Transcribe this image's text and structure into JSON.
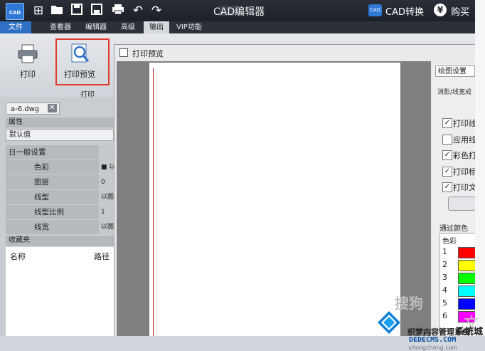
{
  "titlebar": {
    "app_logo": "CAD",
    "title": "CAD编辑器",
    "convert_label": "CAD转换",
    "convert_badge": "CAD",
    "buy_label": "购买",
    "buy_icon": "¥",
    "toolbar_icons": [
      "add-icon",
      "open-folder-icon",
      "save-icon",
      "save-as-icon",
      "print-icon",
      "undo-icon",
      "redo-icon"
    ]
  },
  "menu": {
    "tabs": [
      "文件",
      "查看器",
      "编辑器",
      "高级",
      "输出",
      "VIP功能"
    ],
    "active": "输出"
  },
  "ribbon": {
    "print_label": "打印",
    "preview_label": "打印预览",
    "group_label": "打印",
    "highlight_color": "#e03b2a"
  },
  "leftpanel": {
    "file_tab": "a-6.dwg",
    "file_close": "✕",
    "properties_header": "属性",
    "default_value": "默认值",
    "general_group": "日一般设置",
    "rows": [
      {
        "key": "色彩",
        "value": "■ 以"
      },
      {
        "key": "图层",
        "value": "0"
      },
      {
        "key": "线型",
        "value": "以图"
      },
      {
        "key": "线型比例",
        "value": "1"
      },
      {
        "key": "线宽",
        "value": "以图"
      }
    ],
    "favorites_header": "收藏夹",
    "fav_columns": [
      "名称",
      "路径"
    ]
  },
  "preview": {
    "window_title": "打印预览",
    "settings_tab": "绘图设置",
    "line_width_text": "消影/线宽成",
    "checkboxes": [
      {
        "label": "打印线",
        "checked": true
      },
      {
        "label": "应用线",
        "checked": false
      },
      {
        "label": "彩色打",
        "checked": true
      },
      {
        "label": "打印标",
        "checked": true
      },
      {
        "label": "打印文",
        "checked": true
      }
    ],
    "color_section_label": "通过颜色",
    "color_header": "色彩",
    "colors": [
      {
        "index": "1",
        "hex": "#ff0000"
      },
      {
        "index": "2",
        "hex": "#ffff00"
      },
      {
        "index": "3",
        "hex": "#00ff00"
      },
      {
        "index": "4",
        "hex": "#00ffff"
      },
      {
        "index": "5",
        "hex": "#0000ff"
      },
      {
        "index": "6",
        "hex": "#ff00ff"
      }
    ]
  },
  "watermarks": {
    "sogou": "搜狗",
    "wen": "文",
    "site_name": "系统城",
    "site_cn": "织梦内容管理系统",
    "site_url": "DEDECMS.COM",
    "site_url2": "xitongcheng.com"
  }
}
